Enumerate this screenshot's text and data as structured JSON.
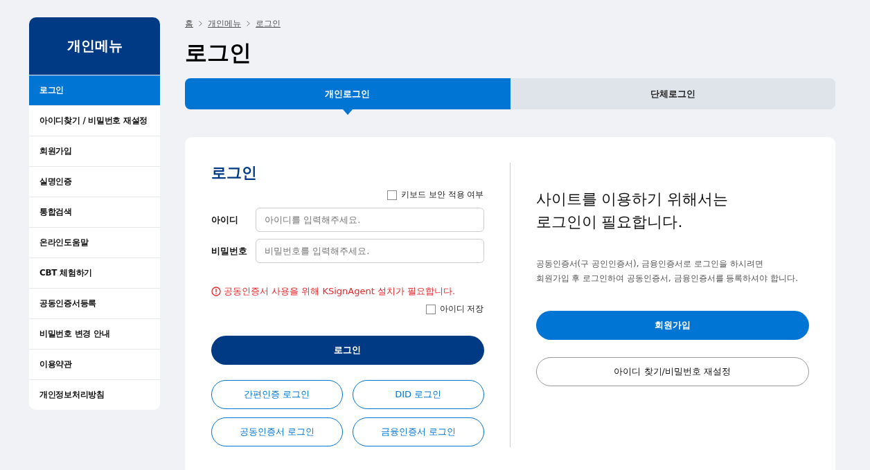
{
  "sidebar": {
    "title": "개인메뉴",
    "items": [
      {
        "label": "로그인",
        "selected": true
      },
      {
        "label": "아이디찾기 / 비밀번호 재설정",
        "selected": false
      },
      {
        "label": "회원가입",
        "selected": false
      },
      {
        "label": "실명인증",
        "selected": false
      },
      {
        "label": "통합검색",
        "selected": false
      },
      {
        "label": "온라인도움말",
        "selected": false
      },
      {
        "label": "CBT 체험하기",
        "selected": false
      },
      {
        "label": "공동인증서등록",
        "selected": false
      },
      {
        "label": "비밀번호 변경 안내",
        "selected": false
      },
      {
        "label": "이용약관",
        "selected": false
      },
      {
        "label": "개인정보처리방침",
        "selected": false
      }
    ]
  },
  "breadcrumb": [
    "홈",
    "개인메뉴",
    "로그인"
  ],
  "page_title": "로그인",
  "tabs": [
    {
      "label": "개인로그인",
      "selected": true
    },
    {
      "label": "단체로그인",
      "selected": false
    }
  ],
  "login": {
    "title": "로그인",
    "keyboard_security": {
      "label": "키보드 보안 적용 여부",
      "checked": false
    },
    "fields": [
      {
        "label": "아이디",
        "placeholder": "아이디를 입력해주세요."
      },
      {
        "label": "비밀번호",
        "placeholder": "비밀번호를 입력해주세요."
      }
    ],
    "warning": "공동인증서 사용을 위해 KSignAgent 설치가 필요합니다.",
    "save_id": {
      "label": "아이디 저장",
      "checked": false
    },
    "login_button": "로그인",
    "alt_buttons": [
      "간편인증 로그인",
      "DID 로그인",
      "공동인증서 로그인",
      "금융인증서 로그인"
    ]
  },
  "info": {
    "heading": [
      "사이트를 이용하기 위해서는",
      "로그인이 필요합니다."
    ],
    "description": [
      "공동인증서(구 공인인증서), 금융인증서로 로그인을 하시려면",
      "회원가입 후 로그인하여 공동인증서, 금융인증서를 등록하셔야 합니다."
    ],
    "buttons": [
      {
        "label": "회원가입",
        "kind": "primary"
      },
      {
        "label": "아이디 찾기/비밀번호 재설정",
        "kind": "outline"
      }
    ]
  }
}
